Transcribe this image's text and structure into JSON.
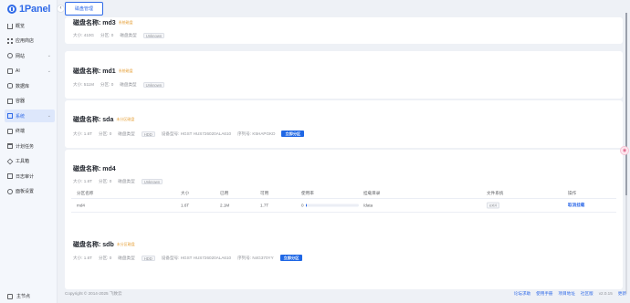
{
  "app": {
    "logo_text": "1Panel",
    "collapse_glyph": "‹"
  },
  "sidebar": {
    "items": [
      {
        "label": "概览",
        "icon": "home-icon",
        "has_chevron": false,
        "active": false
      },
      {
        "label": "应用商店",
        "icon": "grid-icon",
        "has_chevron": false,
        "active": false
      },
      {
        "label": "网站",
        "icon": "globe-icon",
        "has_chevron": true,
        "active": false
      },
      {
        "label": "AI",
        "icon": "ai-icon",
        "has_chevron": true,
        "active": false
      },
      {
        "label": "数据库",
        "icon": "database-icon",
        "has_chevron": false,
        "active": false
      },
      {
        "label": "容器",
        "icon": "container-icon",
        "has_chevron": false,
        "active": false
      },
      {
        "label": "系统",
        "icon": "system-icon",
        "has_chevron": true,
        "active": true
      },
      {
        "label": "终端",
        "icon": "terminal-icon",
        "has_chevron": false,
        "active": false
      },
      {
        "label": "计划任务",
        "icon": "calendar-icon",
        "has_chevron": false,
        "active": false
      },
      {
        "label": "工具箱",
        "icon": "toolbox-icon",
        "has_chevron": false,
        "active": false
      },
      {
        "label": "日志审计",
        "icon": "log-icon",
        "has_chevron": false,
        "active": false
      },
      {
        "label": "面板设置",
        "icon": "settings-icon",
        "has_chevron": false,
        "active": false
      }
    ],
    "chevron_glyph": "⌄",
    "footer_label": "主节点"
  },
  "header": {
    "tab_label": "磁盘管理"
  },
  "disk_prefix": "磁盘名称: ",
  "labels": {
    "size": "大小",
    "partitions": "分区",
    "disk_type": "磁盘类型",
    "model": "设备型号",
    "serial": "序列号",
    "partition_button": "立即分区"
  },
  "disks": [
    {
      "name": "md3",
      "tag": "系统磁盘",
      "size": "410G",
      "partitions": "0",
      "type": "Unknown"
    },
    {
      "name": "md1",
      "tag": "系统磁盘",
      "size": "511M",
      "partitions": "0",
      "type": "Unknown"
    },
    {
      "name": "sda",
      "tag": "未分区磁盘",
      "size": "1.6T",
      "partitions": "0",
      "type": "HDD",
      "model": "HGST HUS726020ALA610",
      "serial": "K5HAPGKD"
    },
    {
      "name": "md4",
      "tag": "",
      "size": "1.6T",
      "partitions": "0",
      "type": "Unknown"
    },
    {
      "name": "sdb",
      "tag": "未分区磁盘",
      "size": "1.6T",
      "partitions": "0",
      "type": "HDD",
      "model": "HGST HUS726020ALA610",
      "serial": "N4G370YY"
    }
  ],
  "partition_table": {
    "columns": [
      "分区名称",
      "大小",
      "已用",
      "可用",
      "使用率",
      "挂载目录",
      "文件系统",
      "操作"
    ],
    "rows": [
      {
        "name": "md4",
        "size": "1.6T",
        "used": "2.1M",
        "available": "1.7T",
        "usage_percent": 1,
        "usage_label": "0",
        "mount": "/data",
        "fs": "ext4",
        "action": "取消挂载"
      }
    ]
  },
  "footer": {
    "copyright": "Copyright © 2014-2025 飞致云",
    "links": [
      "论坛求助",
      "使用手册",
      "项目地址",
      "社区版"
    ],
    "version": "v2.0.15",
    "update": "更新"
  },
  "colors": {
    "accent": "#2f6ae8",
    "warning": "#e6a23c",
    "bg": "#eef1f6"
  }
}
